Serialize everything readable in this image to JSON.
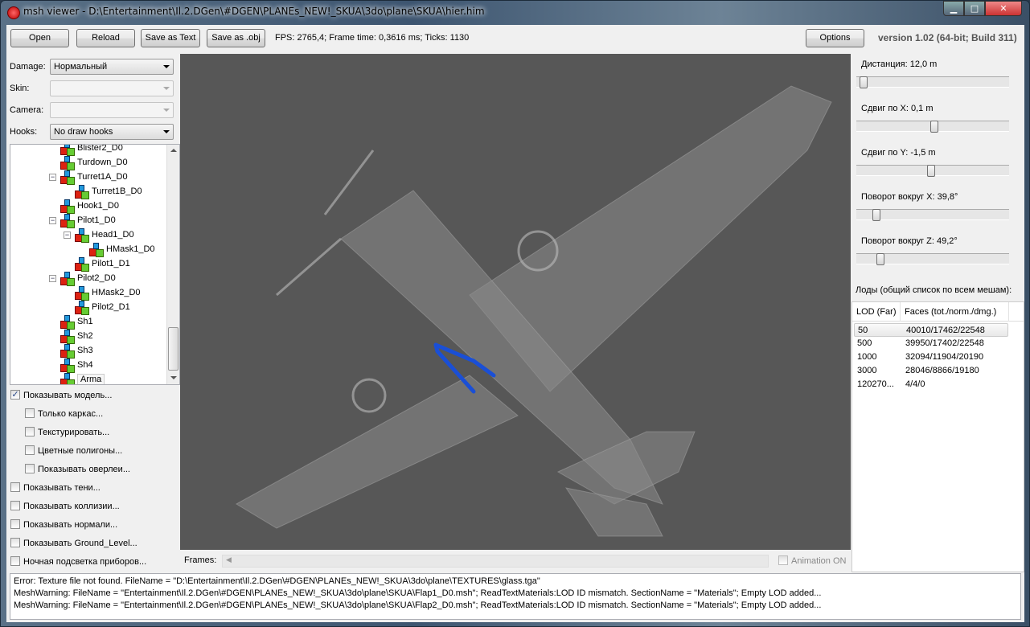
{
  "window": {
    "title": "msh viewer - D:\\Entertainment\\Il.2.DGen\\#DGEN\\PLANEs_NEW!_SKUA\\3do\\plane\\SKUA\\hier.him"
  },
  "toolbar": {
    "open": "Open",
    "reload": "Reload",
    "save_text": "Save as Text",
    "save_obj": "Save as .obj",
    "stats": "FPS: 2765,4; Frame time: 0,3616 ms; Ticks: 1130",
    "options": "Options",
    "version": "version 1.02 (64-bit; Build 311)"
  },
  "left": {
    "damage_label": "Damage:",
    "damage_value": "Нормальный",
    "skin_label": "Skin:",
    "camera_label": "Camera:",
    "hooks_label": "Hooks:",
    "hooks_value": "No draw hooks",
    "tree": [
      {
        "label": "Blister2_D0",
        "level": 0
      },
      {
        "label": "Turdown_D0",
        "level": 0
      },
      {
        "label": "Turret1A_D0",
        "level": 0,
        "expanded": true
      },
      {
        "label": "Turret1B_D0",
        "level": 1
      },
      {
        "label": "Hook1_D0",
        "level": 0
      },
      {
        "label": "Pilot1_D0",
        "level": 0,
        "expanded": true
      },
      {
        "label": "Head1_D0",
        "level": 1,
        "expanded": true
      },
      {
        "label": "HMask1_D0",
        "level": 2
      },
      {
        "label": "Pilot1_D1",
        "level": 1
      },
      {
        "label": "Pilot2_D0",
        "level": 0,
        "expanded": true
      },
      {
        "label": "HMask2_D0",
        "level": 1
      },
      {
        "label": "Pilot2_D1",
        "level": 1
      },
      {
        "label": "Sh1",
        "level": 0
      },
      {
        "label": "Sh2",
        "level": 0
      },
      {
        "label": "Sh3",
        "level": 0
      },
      {
        "label": "Sh4",
        "level": 0
      },
      {
        "label": "Arma",
        "level": 0,
        "selected": true
      }
    ],
    "checks": [
      {
        "label": "Показывать модель...",
        "checked": true,
        "indent": 0
      },
      {
        "label": "Только каркас...",
        "checked": false,
        "indent": 1
      },
      {
        "label": "Текстурировать...",
        "checked": false,
        "indent": 1
      },
      {
        "label": "Цветные полигоны...",
        "checked": false,
        "indent": 1
      },
      {
        "label": "Показывать оверлеи...",
        "checked": false,
        "indent": 1
      },
      {
        "label": "Показывать тени...",
        "checked": false,
        "indent": 0
      },
      {
        "label": "Показывать коллизии...",
        "checked": false,
        "indent": 0
      },
      {
        "label": "Показывать нормали...",
        "checked": false,
        "indent": 0
      },
      {
        "label": "Показывать Ground_Level...",
        "checked": false,
        "indent": 0
      },
      {
        "label": "Ночная подсветка приборов...",
        "checked": false,
        "indent": 0
      }
    ]
  },
  "frames": {
    "label": "Frames:",
    "animation": "Animation ON"
  },
  "right": {
    "sliders": [
      {
        "label": "Дистанция:  12,0 m",
        "fraction": 0.02
      },
      {
        "label": "Сдвиг по X:  0,1 m",
        "fraction": 0.51
      },
      {
        "label": "Сдвиг по Y:  -1,5 m",
        "fraction": 0.49
      },
      {
        "label": "Поворот вокруг X:  39,8°",
        "fraction": 0.11
      },
      {
        "label": "Поворот вокруг Z:  49,2°",
        "fraction": 0.14
      }
    ],
    "lods_title": "Лоды (общий список по всем мешам):",
    "lod_headers": [
      "LOD (Far)",
      "Faces (tot./norm./dmg.)"
    ],
    "lods": [
      [
        "50",
        "40010/17462/22548"
      ],
      [
        "500",
        "39950/17402/22548"
      ],
      [
        "1000",
        "32094/11904/20190"
      ],
      [
        "3000",
        "28046/8866/19180"
      ],
      [
        "120270...",
        "4/4/0"
      ]
    ]
  },
  "log": [
    "Error: Texture file not found. FileName = \"D:\\Entertainment\\Il.2.DGen\\#DGEN\\PLANEs_NEW!_SKUA\\3do\\plane\\TEXTURES\\glass.tga\"",
    "MeshWarning: FileName = \"Entertainment\\Il.2.DGen\\#DGEN\\PLANEs_NEW!_SKUA\\3do\\plane\\SKUA\\Flap1_D0.msh\"; ReadTextMaterials:LOD ID mismatch. SectionName = \"Materials\"; Empty LOD added...",
    "MeshWarning: FileName = \"Entertainment\\Il.2.DGen\\#DGEN\\PLANEs_NEW!_SKUA\\3do\\plane\\SKUA\\Flap2_D0.msh\"; ReadTextMaterials:LOD ID mismatch. SectionName = \"Materials\"; Empty LOD added..."
  ]
}
